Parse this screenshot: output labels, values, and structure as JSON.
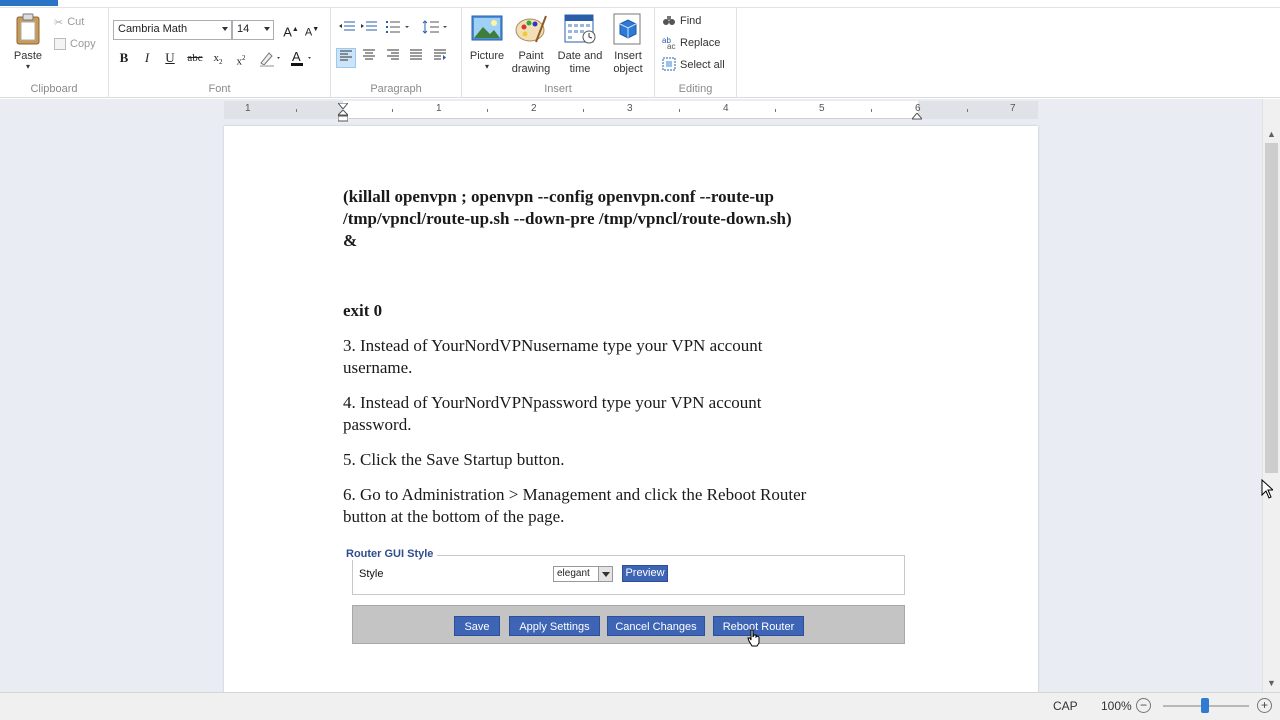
{
  "ribbon": {
    "clipboard": {
      "label": "Clipboard",
      "paste": "Paste",
      "cut": "Cut",
      "copy": "Copy"
    },
    "font": {
      "label": "Font",
      "family": "Cambria Math",
      "size": "14"
    },
    "paragraph": {
      "label": "Paragraph"
    },
    "insert": {
      "label": "Insert",
      "picture": "Picture",
      "paint_line1": "Paint",
      "paint_line2": "drawing",
      "datetime_line1": "Date and",
      "datetime_line2": "time",
      "object_line1": "Insert",
      "object_line2": "object"
    },
    "editing": {
      "label": "Editing",
      "find": "Find",
      "replace": "Replace",
      "select_all": "Select all"
    }
  },
  "ruler": {
    "numbers": [
      "1",
      "1",
      "2",
      "3",
      "4",
      "5",
      "6",
      "7"
    ]
  },
  "document": {
    "command_line1": "(killall openvpn ; openvpn --config openvpn.conf --route-up",
    "command_line2": "/tmp/vpncl/route-up.sh --down-pre /tmp/vpncl/route-down.sh)",
    "command_line3": "&",
    "exit": "exit 0",
    "step3_line1": "3. Instead of YourNordVPNusername type your VPN account",
    "step3_line2": "username.",
    "step4_line1": "4. Instead of YourNordVPNpassword type your VPN account",
    "step4_line2": "password.",
    "step5": "5. Click the Save Startup button.",
    "step6_line1": "6. Go to Administration > Management and click the Reboot Router",
    "step6_line2": "button at the bottom of the page."
  },
  "router_gui": {
    "legend": "Router GUI Style",
    "style_label": "Style",
    "style_value": "elegant",
    "preview": "Preview",
    "save": "Save",
    "apply": "Apply Settings",
    "cancel": "Cancel Changes",
    "reboot": "Reboot Router"
  },
  "status": {
    "caps": "CAP",
    "zoom": "100%",
    "zoom_minus": "−",
    "zoom_plus": "+"
  },
  "colors": {
    "accent": "#2b73c5",
    "router_button": "#3d64b5",
    "router_legend": "#2f4d8f",
    "workspace": "#e9edf3"
  }
}
